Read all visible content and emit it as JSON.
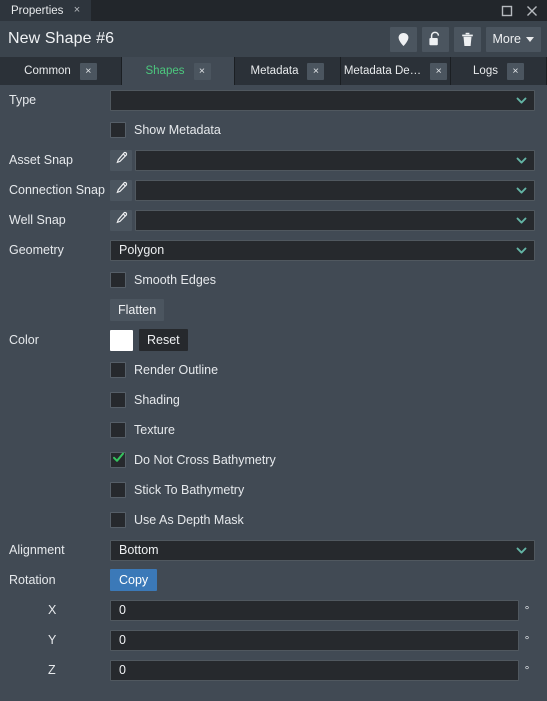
{
  "window": {
    "tab_title": "Properties",
    "tab_close": "×",
    "maximize_icon": "maximize-icon",
    "close_icon": "close-icon"
  },
  "header": {
    "title": "New Shape #6",
    "buttons": [
      {
        "name": "pin-button",
        "icon": "map-pin-icon"
      },
      {
        "name": "unlock-button",
        "icon": "unlock-icon"
      },
      {
        "name": "delete-button",
        "icon": "trash-icon"
      }
    ],
    "more_label": "More"
  },
  "tabs": [
    {
      "label": "Common",
      "active": false,
      "close": "×"
    },
    {
      "label": "Shapes",
      "active": true,
      "close": "×"
    },
    {
      "label": "Metadata",
      "active": false,
      "close": "×"
    },
    {
      "label": "Metadata De…",
      "active": false,
      "close": "×"
    },
    {
      "label": "Logs",
      "active": false,
      "close": "×"
    }
  ],
  "form": {
    "type": {
      "label": "Type",
      "value": ""
    },
    "show_metadata": {
      "label": "Show Metadata",
      "checked": false
    },
    "asset_snap": {
      "label": "Asset Snap",
      "value": ""
    },
    "connection_snap": {
      "label": "Connection Snap",
      "value": ""
    },
    "well_snap": {
      "label": "Well Snap",
      "value": ""
    },
    "geometry": {
      "label": "Geometry",
      "value": "Polygon"
    },
    "smooth_edges": {
      "label": "Smooth Edges",
      "checked": false
    },
    "flatten_label": "Flatten",
    "color": {
      "label": "Color",
      "swatch": "#ffffff",
      "reset_label": "Reset"
    },
    "render_outline": {
      "label": "Render Outline",
      "checked": false
    },
    "shading": {
      "label": "Shading",
      "checked": false
    },
    "texture": {
      "label": "Texture",
      "checked": false
    },
    "do_not_cross_bathymetry": {
      "label": "Do Not Cross Bathymetry",
      "checked": true
    },
    "stick_to_bathymetry": {
      "label": "Stick To Bathymetry",
      "checked": false
    },
    "use_as_depth_mask": {
      "label": "Use As Depth Mask",
      "checked": false
    },
    "alignment": {
      "label": "Alignment",
      "value": "Bottom"
    },
    "rotation": {
      "label": "Rotation",
      "copy_label": "Copy",
      "unit": "°",
      "axes": [
        {
          "label": "X",
          "value": "0"
        },
        {
          "label": "Y",
          "value": "0"
        },
        {
          "label": "Z",
          "value": "0"
        }
      ]
    }
  },
  "colors": {
    "panel_bg": "#414a54",
    "titlebar_bg": "#22262b",
    "field_bg": "#26292d",
    "accent_green": "#4cc87e",
    "accent_blue": "#3b79b8",
    "chevron_teal": "#63b4a4"
  }
}
